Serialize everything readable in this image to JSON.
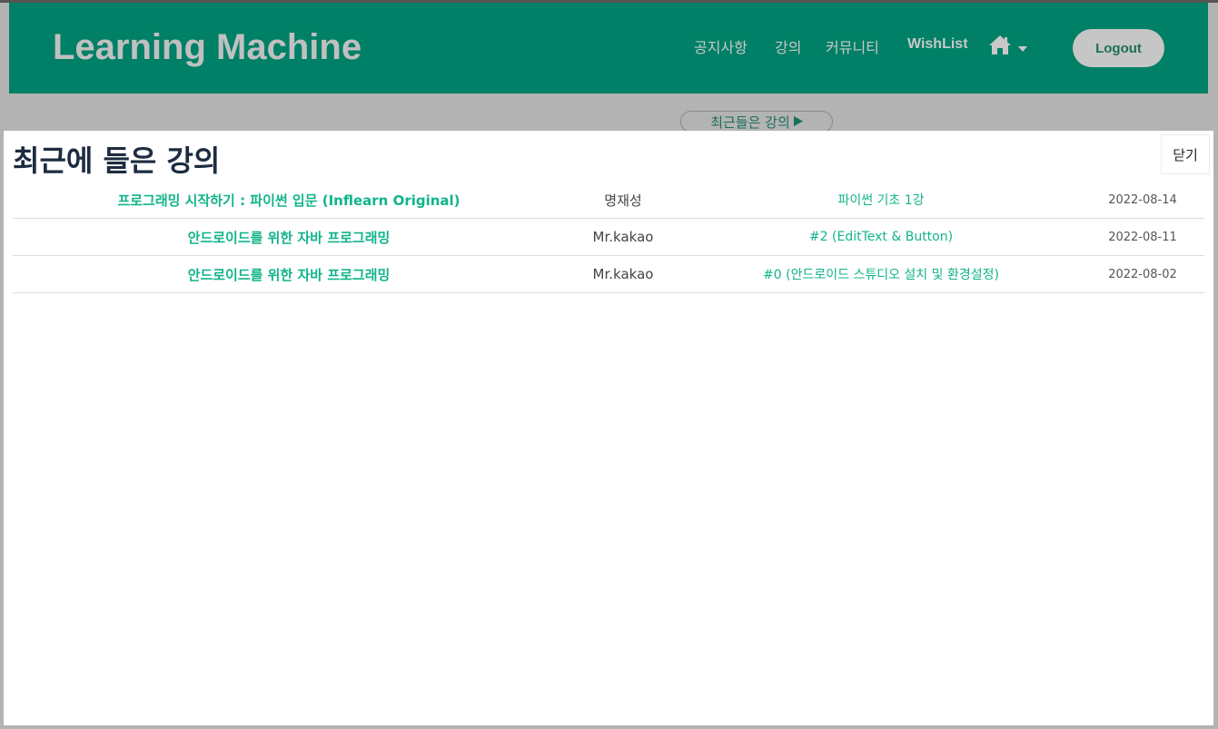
{
  "header": {
    "brand": "Learning Machine",
    "nav": [
      {
        "label": "공지사항"
      },
      {
        "label": "강의"
      },
      {
        "label": "커뮤니티"
      },
      {
        "label": "WishList"
      }
    ],
    "logout_label": "Logout",
    "colors": {
      "header_bg": "#008066",
      "accent": "#12b48a"
    }
  },
  "recent_toggle": {
    "label": "최근들은 강의"
  },
  "modal": {
    "title": "최근에 들은 강의",
    "close_label": "닫기",
    "rows": [
      {
        "course": "프로그래밍 시작하기 : 파이썬 입문 (Inflearn Original)",
        "teacher": "명재성",
        "lesson": "파이썬 기초 1강",
        "date": "2022-08-14"
      },
      {
        "course": "안드로이드를 위한 자바 프로그래밍",
        "teacher": "Mr.kakao",
        "lesson": "#2 (EditText & Button)",
        "date": "2022-08-11"
      },
      {
        "course": "안드로이드를 위한 자바 프로그래밍",
        "teacher": "Mr.kakao",
        "lesson": "#0 (안드로이드 스튜디오 설치 및 환경설정)",
        "date": "2022-08-02"
      }
    ]
  }
}
